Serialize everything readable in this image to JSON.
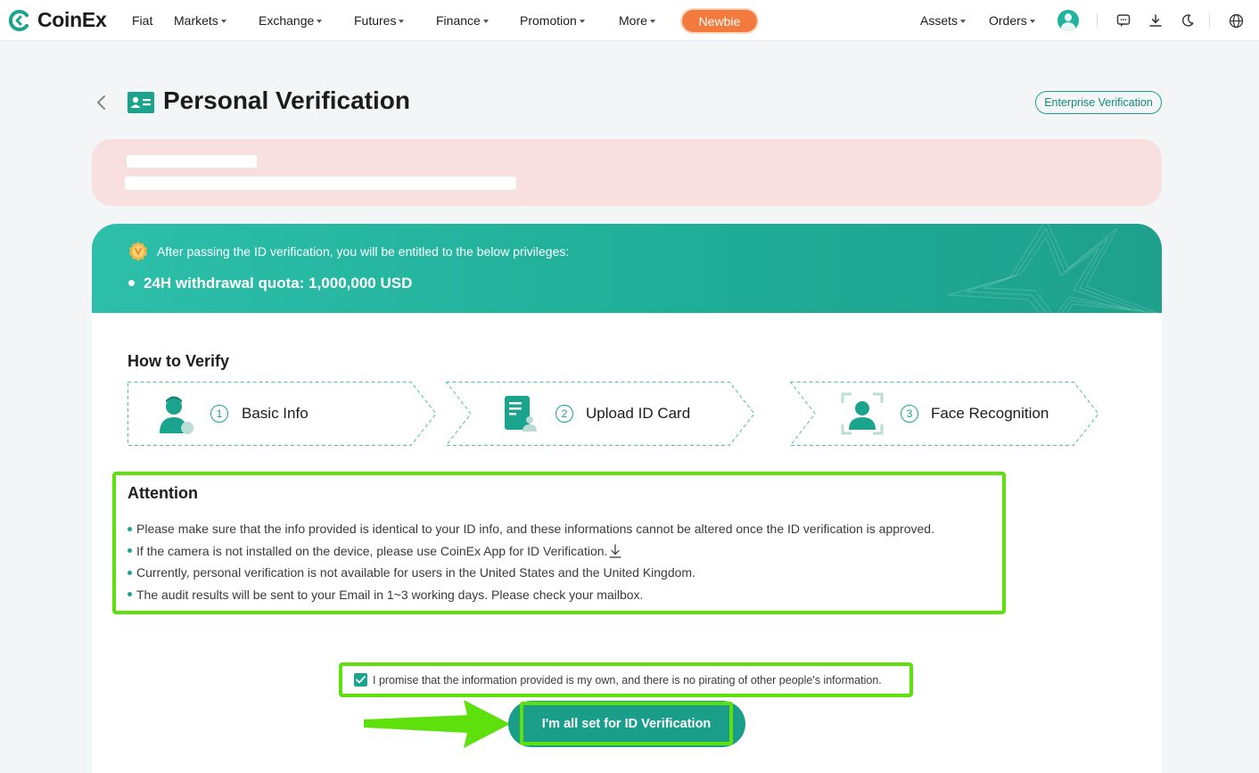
{
  "brand": {
    "name": "CoinEx",
    "accent": "#1aa38d",
    "highlight": "#5ee00d",
    "newbie_color": "#f27a3c"
  },
  "nav": {
    "items": [
      {
        "label": "Fiat",
        "has_caret": false
      },
      {
        "label": "Markets",
        "has_caret": true
      },
      {
        "label": "Exchange",
        "has_caret": true
      },
      {
        "label": "Futures",
        "has_caret": true
      },
      {
        "label": "Finance",
        "has_caret": true
      },
      {
        "label": "Promotion",
        "has_caret": true
      },
      {
        "label": "More",
        "has_caret": true
      }
    ],
    "newbie": "Newbie",
    "right": {
      "assets": "Assets",
      "orders": "Orders"
    },
    "icons": [
      "avatar",
      "message-icon",
      "download-icon",
      "moon-icon",
      "globe-icon"
    ]
  },
  "page": {
    "title": "Personal Verification",
    "enterprise_button": "Enterprise Verification"
  },
  "banner": {
    "intro": "After passing the ID verification, you will be entitled to the below privileges:",
    "quota": "24H withdrawal quota: 1,000,000 USD"
  },
  "how_to_verify": {
    "title": "How to Verify",
    "steps": [
      {
        "num": "1",
        "label": "Basic Info",
        "icon": "person-icon"
      },
      {
        "num": "2",
        "label": "Upload ID Card",
        "icon": "id-card-icon"
      },
      {
        "num": "3",
        "label": "Face Recognition",
        "icon": "face-scan-icon"
      }
    ]
  },
  "attention": {
    "title": "Attention",
    "items": [
      "Please make sure that the info provided is identical to your ID info, and these informations cannot be altered once the ID verification is approved.",
      "If the camera is not installed on the device, please use CoinEx App for ID Verification.",
      "Currently, personal verification is not available for users in the United States and the United Kingdom.",
      "The audit results will be sent to your Email in 1~3 working days. Please check your mailbox."
    ]
  },
  "promise": {
    "checked": true,
    "text": "I promise that the information provided is my own, and there is no pirating of other people's information."
  },
  "submit": {
    "label": "I'm all set for ID Verification"
  }
}
